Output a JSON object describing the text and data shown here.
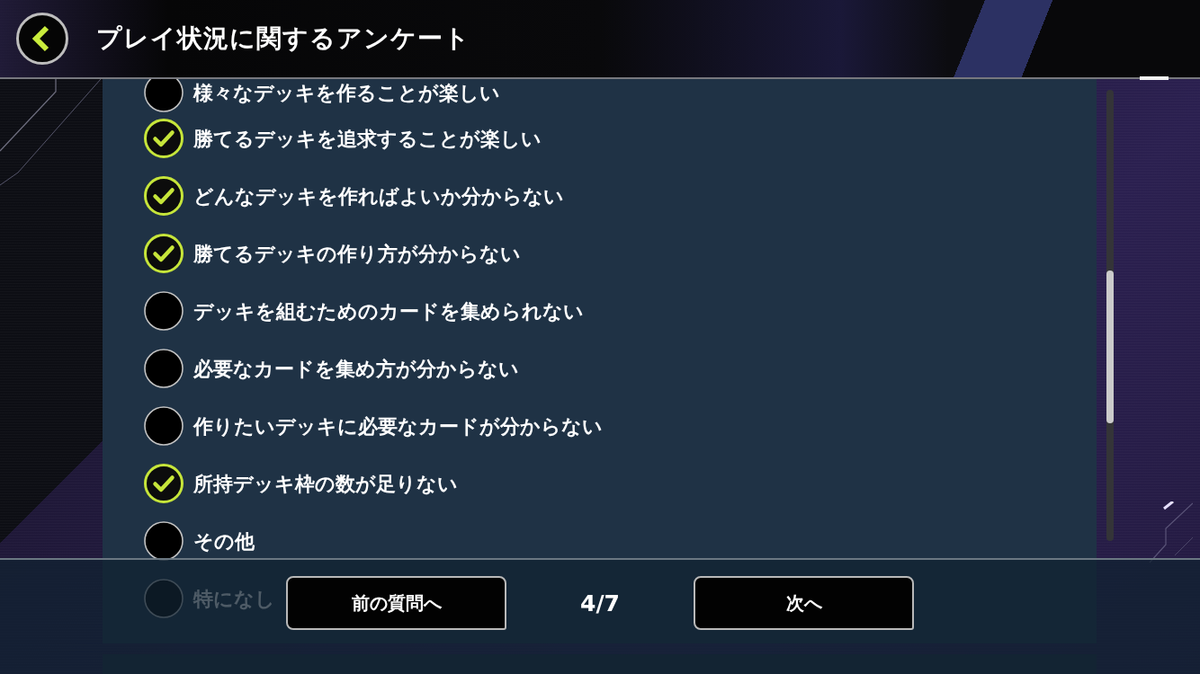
{
  "header": {
    "title": "プレイ状況に関するアンケート"
  },
  "options": [
    {
      "kind": "checkbox",
      "label": "様々なデッキを作ることが楽しい",
      "checked": false
    },
    {
      "kind": "checkbox",
      "label": "勝てるデッキを追求することが楽しい",
      "checked": true
    },
    {
      "kind": "checkbox",
      "label": "どんなデッキを作ればよいか分からない",
      "checked": true
    },
    {
      "kind": "checkbox",
      "label": "勝てるデッキの作り方が分からない",
      "checked": true
    },
    {
      "kind": "checkbox",
      "label": "デッキを組むためのカードを集められない",
      "checked": false
    },
    {
      "kind": "checkbox",
      "label": "必要なカードを集め方が分からない",
      "checked": false
    },
    {
      "kind": "checkbox",
      "label": "作りたいデッキに必要なカードが分からない",
      "checked": false
    },
    {
      "kind": "checkbox",
      "label": "所持デッキ枠の数が足りない",
      "checked": true
    },
    {
      "kind": "checkbox",
      "label": "その他",
      "checked": false
    },
    {
      "kind": "checkbox",
      "label": "特になし",
      "checked": false
    }
  ],
  "footer": {
    "previous_button": "前の質問へ",
    "page": "4/7",
    "next_button": "次へ"
  }
}
